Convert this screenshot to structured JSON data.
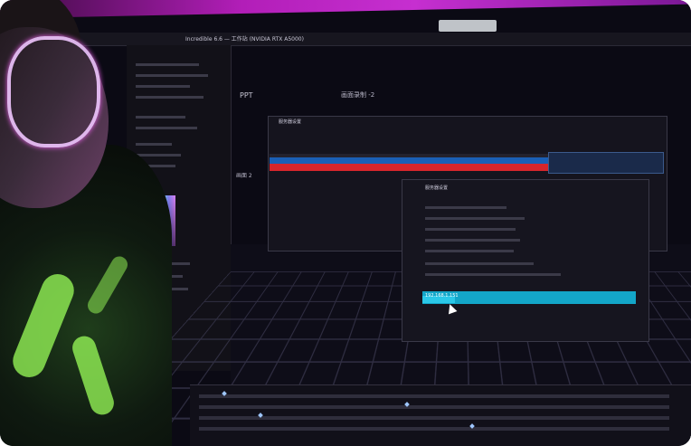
{
  "window_title": "Incredible 6.6 — 工作站 (NVIDIA RTX A5000)",
  "labels": {
    "ppt": "PPT",
    "scene": "画面录制 -2",
    "screen2": "画面 2",
    "dialog1": "服务器设置",
    "dialog2": "服务器设置",
    "ip": "192.168.1.151"
  }
}
